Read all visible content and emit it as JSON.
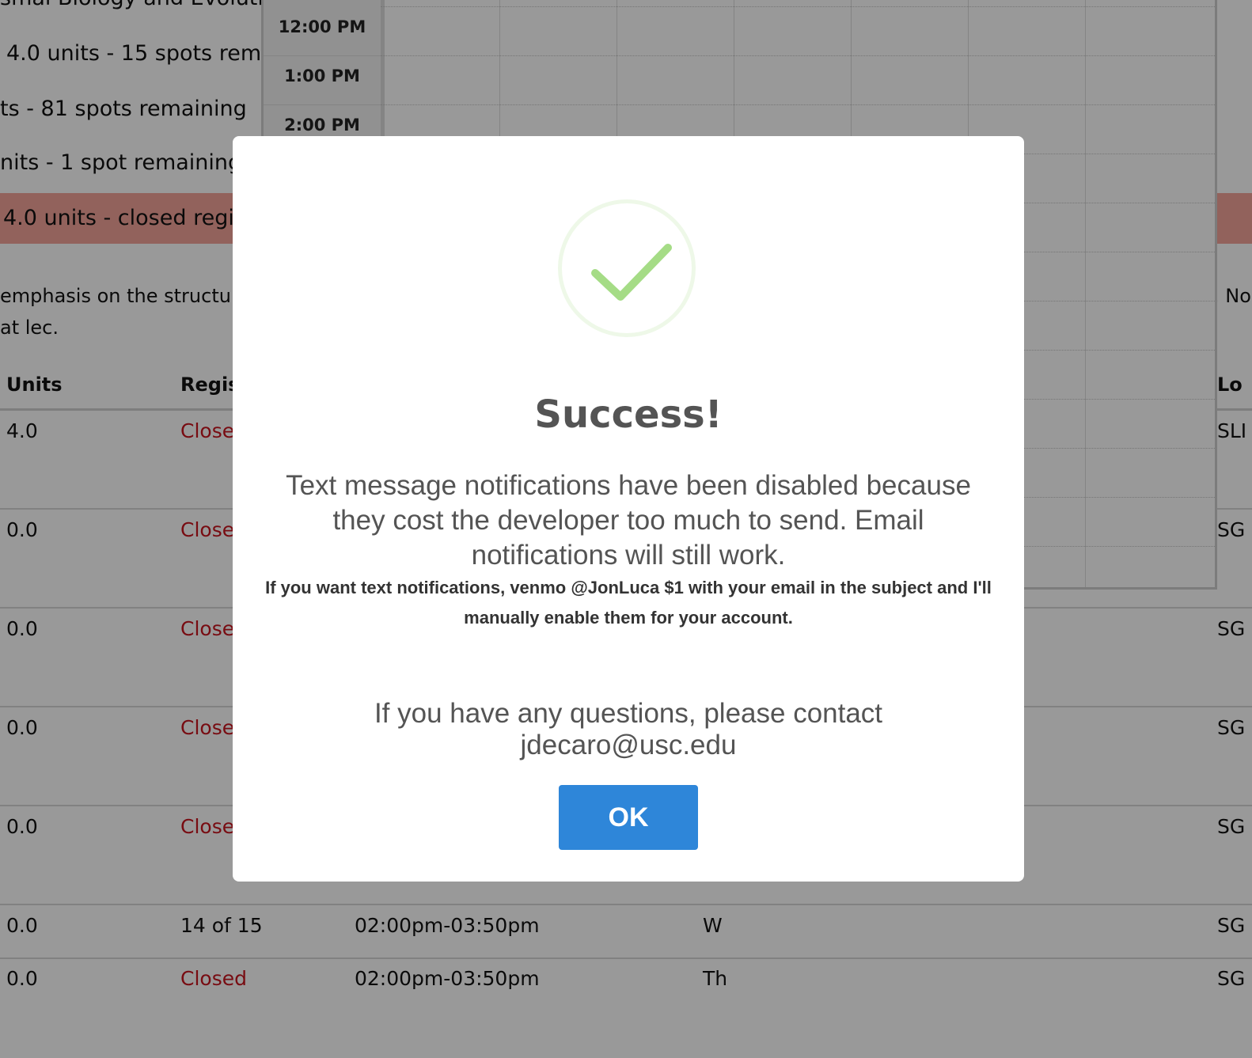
{
  "course_list": {
    "course_title_fragment": "smal Biology and Evolutio",
    "sections": [
      {
        "text": "4.0 units   - 15 spots rema"
      },
      {
        "text": "ts   - 81 spots remaining"
      },
      {
        "text": "nits   - 1 spot remaining"
      },
      {
        "text": "4.0 units   - closed regi"
      }
    ],
    "description_line1": "emphasis on the structur",
    "description_line2": "at lec.",
    "description_right_fragment": ". No"
  },
  "table": {
    "headers": {
      "units": "Units",
      "registered": "Regis",
      "location": "Lo"
    },
    "rows": [
      {
        "units": "4.0",
        "registered": "Close",
        "time": "",
        "days": "",
        "location": "SLI"
      },
      {
        "units": "0.0",
        "registered": "Close",
        "time": "",
        "days": "",
        "location": "SG"
      },
      {
        "units": "0.0",
        "registered": "Close",
        "time": "",
        "days": "",
        "location": "SG"
      },
      {
        "units": "0.0",
        "registered": "Close",
        "time": "",
        "days": "",
        "location": "SG"
      },
      {
        "units": "0.0",
        "registered": "Close",
        "time": "",
        "days": "",
        "location": "SG"
      },
      {
        "units": "0.0",
        "registered": "14 of 15",
        "time": "02:00pm-03:50pm",
        "days": "W",
        "location": "SG"
      },
      {
        "units": "0.0",
        "registered": "Closed",
        "time": "02:00pm-03:50pm",
        "days": "Th",
        "location": "SG"
      }
    ]
  },
  "calendar": {
    "times": [
      "12:00 PM",
      "1:00 PM",
      "2:00 PM"
    ]
  },
  "modal": {
    "icon": "checkmark-icon",
    "title": "Success!",
    "text": "Text message notifications have been disabled because they cost the developer too much to send. Email notifications will still work.",
    "subtext": "If you want text notifications, venmo @JonLuca $1 with your email in the subject and I'll manually enable them for your account.",
    "contact": "If you have any questions, please contact jdecaro@usc.edu",
    "ok_label": "OK"
  },
  "colors": {
    "ok_button": "#2e86d9",
    "success_check": "#a5dc86",
    "closed_text": "#c9151e",
    "closed_row": "#f4a49a"
  }
}
